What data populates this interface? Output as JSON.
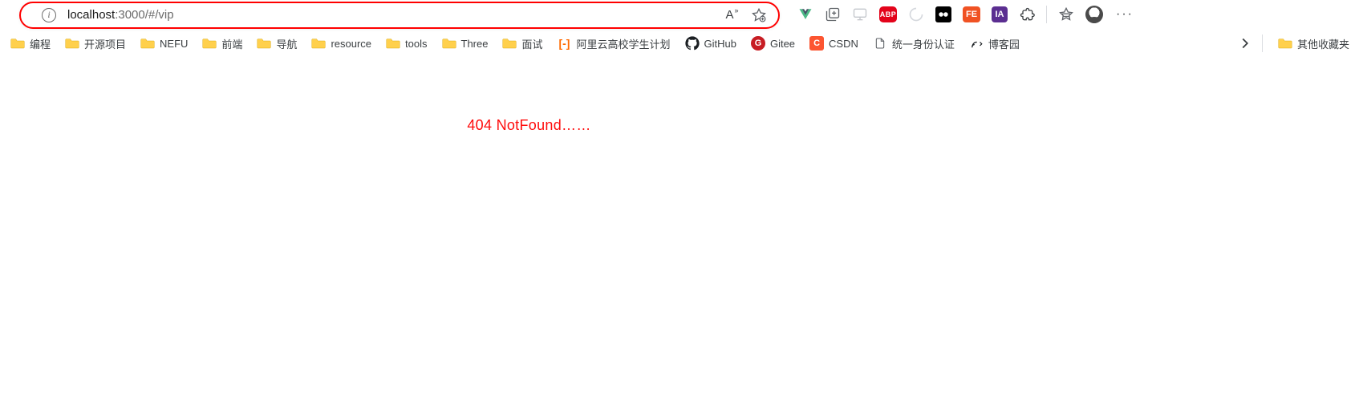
{
  "address_bar": {
    "url_host": "localhost",
    "url_rest": ":3000/#/vip",
    "reader_label": "A",
    "reader_sup": "»"
  },
  "extensions": {
    "abp": "ABP",
    "fe": "FE",
    "ia": "IA",
    "more": "···"
  },
  "bookmarks": [
    {
      "type": "folder",
      "label": "编程"
    },
    {
      "type": "folder",
      "label": "开源项目"
    },
    {
      "type": "folder",
      "label": "NEFU"
    },
    {
      "type": "folder",
      "label": "前端"
    },
    {
      "type": "folder",
      "label": "导航"
    },
    {
      "type": "folder",
      "label": "resource"
    },
    {
      "type": "folder",
      "label": "tools"
    },
    {
      "type": "folder",
      "label": "Three"
    },
    {
      "type": "folder",
      "label": "面试"
    },
    {
      "type": "ali",
      "label": "阿里云高校学生计划"
    },
    {
      "type": "github",
      "label": "GitHub"
    },
    {
      "type": "gitee",
      "badge": "G",
      "label": "Gitee"
    },
    {
      "type": "csdn",
      "badge": "C",
      "label": "CSDN"
    },
    {
      "type": "doc",
      "label": "统一身份认证"
    },
    {
      "type": "cnblogs",
      "label": "博客园"
    }
  ],
  "overflow_label": "其他收藏夹",
  "ali_icon": "[-]",
  "page": {
    "notfound": "404 NotFound……"
  }
}
